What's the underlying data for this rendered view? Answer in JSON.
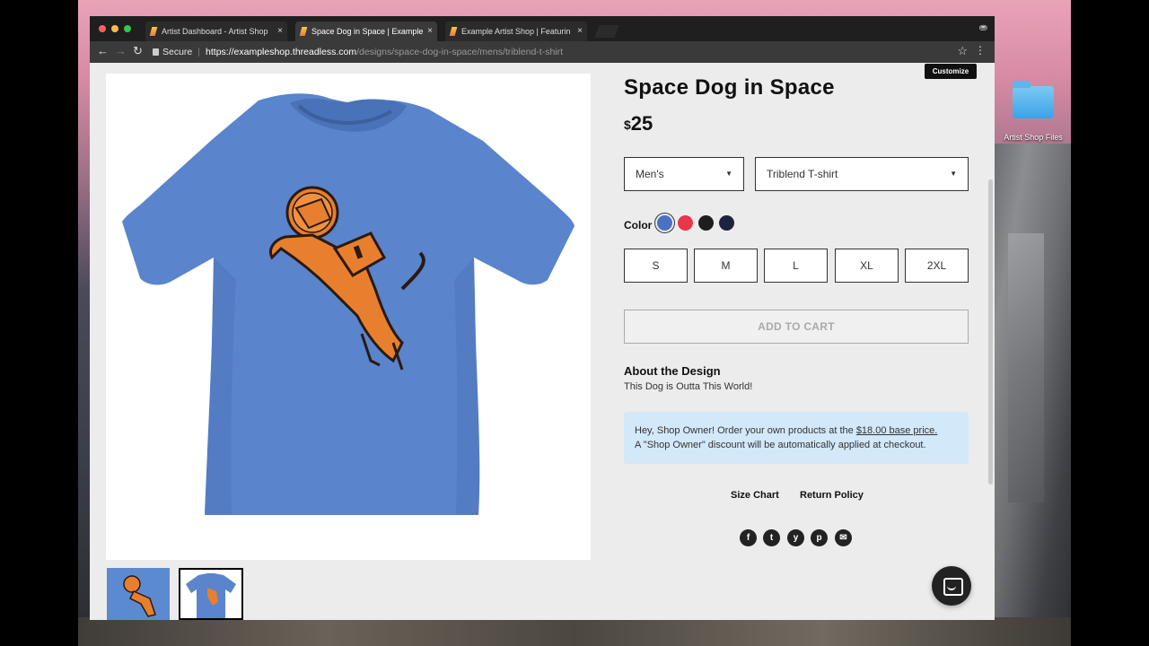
{
  "browser": {
    "tabs": [
      {
        "title": "Artist Dashboard - Artist Shop"
      },
      {
        "title": "Space Dog in Space | Example"
      },
      {
        "title": "Example Artist Shop | Featurin"
      }
    ],
    "address": {
      "secure_label": "Secure",
      "host": "https://exampleshop.threadless.com",
      "path": "/designs/space-dog-in-space/mens/triblend-t-shirt"
    }
  },
  "desktop": {
    "folder_label": "Artist Shop Files"
  },
  "page": {
    "customize_label": "Customize",
    "product": {
      "title": "Space Dog in Space",
      "currency": "$",
      "price": "25",
      "style_select": "Men's",
      "product_select": "Triblend T-shirt",
      "color_label": "Color",
      "colors": [
        {
          "name": "blue",
          "hex": "#4a72c4",
          "selected": true
        },
        {
          "name": "red",
          "hex": "#e8364a",
          "selected": false
        },
        {
          "name": "black",
          "hex": "#1e1e1e",
          "selected": false
        },
        {
          "name": "navy",
          "hex": "#1c2340",
          "selected": false
        }
      ],
      "sizes": [
        "S",
        "M",
        "L",
        "XL",
        "2XL"
      ],
      "add_to_cart": "ADD TO CART"
    },
    "about": {
      "heading": "About the Design",
      "text": "This Dog is Outta This World!"
    },
    "notice": {
      "line1_prefix": "Hey, Shop Owner! Order your own products at the ",
      "line1_link": "$18.00 base price.",
      "line2": "A \"Shop Owner\" discount will be automatically applied at checkout."
    },
    "links": {
      "size_chart": "Size Chart",
      "return_policy": "Return Policy"
    },
    "share": [
      "f",
      "t",
      "y",
      "p",
      "✉"
    ]
  }
}
